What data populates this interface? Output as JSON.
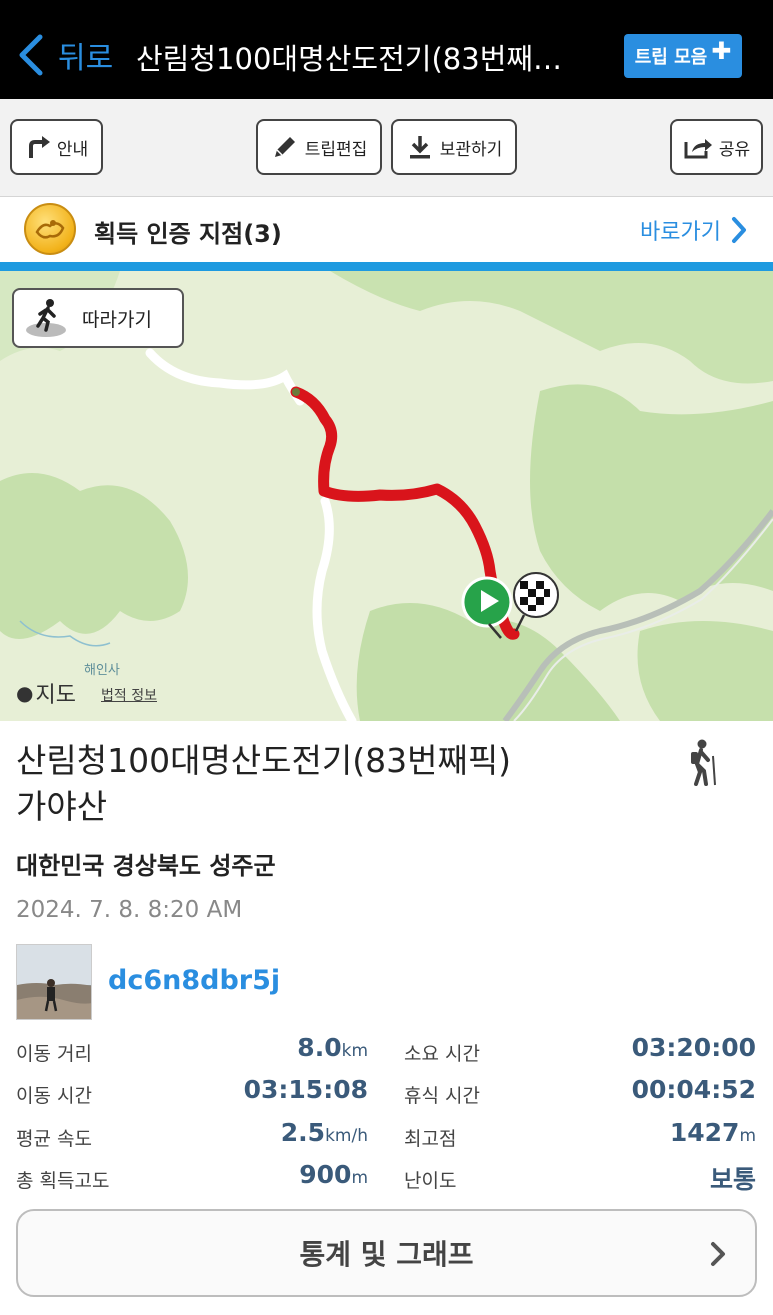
{
  "nav": {
    "back_label": "뒤로",
    "title": "산림청100대명산도전기(83번째…",
    "trip_collection_label": "트립 모음"
  },
  "toolbar": {
    "guide_label": "안내",
    "edit_label": "트립편집",
    "save_label": "보관하기",
    "share_label": "공유"
  },
  "badge_bar": {
    "text": "획득 인증 지점(3)",
    "goto_label": "바로가기"
  },
  "map": {
    "follow_label": "따라가기",
    "maps_logo_text": "지도",
    "legal_label": "법적 정보",
    "place_label": "해인사",
    "route_color": "#d9141b",
    "start_marker": "play-icon",
    "end_marker": "checkered-flag-icon"
  },
  "trip": {
    "title": "산림청100대명산도전기(83번째픽)가야산",
    "region": "대한민국 경상북도 성주군",
    "datetime": "2024. 7. 8. 8:20 AM",
    "username": "dc6n8dbr5j",
    "activity_icon": "hiking-icon"
  },
  "stats": [
    {
      "label": "이동 거리",
      "value": "8.0",
      "unit": "km"
    },
    {
      "label": "소요 시간",
      "value": "03:20:00",
      "unit": ""
    },
    {
      "label": "이동 시간",
      "value": "03:15:08",
      "unit": ""
    },
    {
      "label": "휴식 시간",
      "value": "00:04:52",
      "unit": ""
    },
    {
      "label": "평균 속도",
      "value": "2.5",
      "unit": "km/h"
    },
    {
      "label": "최고점",
      "value": "1427",
      "unit": "m"
    },
    {
      "label": "총 획득고도",
      "value": "900",
      "unit": "m"
    },
    {
      "label": "난이도",
      "value": "보통",
      "unit": ""
    }
  ],
  "stats_button_label": "통계 및 그래프",
  "colors": {
    "accent": "#2a8ee0",
    "topbar": "#000000",
    "stat_value": "#3a5a7a"
  }
}
